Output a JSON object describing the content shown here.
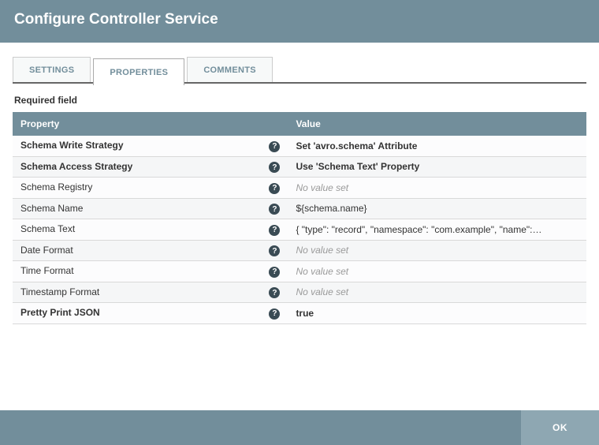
{
  "dialog": {
    "title": "Configure Controller Service"
  },
  "tabs": {
    "settings": "SETTINGS",
    "properties": "PROPERTIES",
    "comments": "COMMENTS"
  },
  "required_label": "Required field",
  "columns": {
    "property": "Property",
    "value": "Value"
  },
  "icons": {
    "help": "?"
  },
  "rows": [
    {
      "name": "Schema Write Strategy",
      "required": true,
      "value": "Set 'avro.schema' Attribute",
      "is_set": true
    },
    {
      "name": "Schema Access Strategy",
      "required": true,
      "value": "Use 'Schema Text' Property",
      "is_set": true
    },
    {
      "name": "Schema Registry",
      "required": false,
      "value": "No value set",
      "is_set": false
    },
    {
      "name": "Schema Name",
      "required": false,
      "value": "${schema.name}",
      "is_set": true
    },
    {
      "name": "Schema Text",
      "required": false,
      "value": "{ \"type\": \"record\", \"namespace\": \"com.example\", \"name\": \"...",
      "is_set": true
    },
    {
      "name": "Date Format",
      "required": false,
      "value": "No value set",
      "is_set": false
    },
    {
      "name": "Time Format",
      "required": false,
      "value": "No value set",
      "is_set": false
    },
    {
      "name": "Timestamp Format",
      "required": false,
      "value": "No value set",
      "is_set": false
    },
    {
      "name": "Pretty Print JSON",
      "required": true,
      "value": "true",
      "is_set": true
    }
  ],
  "footer": {
    "ok": "OK"
  }
}
